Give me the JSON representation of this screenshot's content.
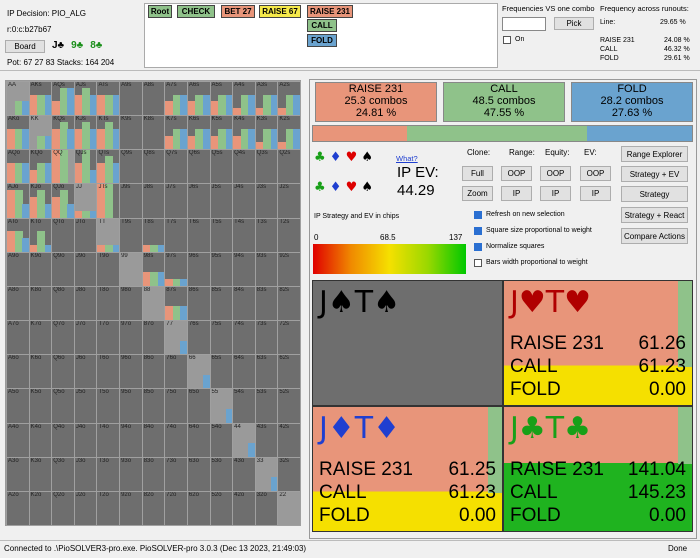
{
  "header": {
    "decision": "IP Decision:  PIO_ALG",
    "board_code": "r:0:c:b27b67",
    "board_button": "Board",
    "board_cards": [
      {
        "r": "J",
        "s": "♣",
        "c": "#000"
      },
      {
        "r": "9",
        "s": "♣",
        "c": "#1a8f1a"
      },
      {
        "r": "8",
        "s": "♣",
        "c": "#1a8f1a"
      }
    ],
    "pot": "Pot: 67 27 83 Stacks: 164 204"
  },
  "tree": {
    "root": "Root",
    "check": "CHECK",
    "bet": "BET 27",
    "raise1": "RAISE 67",
    "raise2": "RAISE 231",
    "call": "CALL",
    "fold": "FOLD"
  },
  "freq_vs_combo": {
    "title": "Frequencies VS one combo",
    "pick": "Pick",
    "on": "On"
  },
  "runouts": {
    "title": "Frequency across runouts:",
    "line_label": "Line:",
    "line_value": "29.65 %",
    "rows": [
      {
        "name": "RAISE 231",
        "pct": "24.08 %"
      },
      {
        "name": "CALL",
        "pct": "46.32 %"
      },
      {
        "name": "FOLD",
        "pct": "29.61 %"
      }
    ]
  },
  "summary": [
    {
      "name": "RAISE 231",
      "combos": "25.3 combos",
      "pct": "24.81 %",
      "color": "#e8957a",
      "frac": 0.2481
    },
    {
      "name": "CALL",
      "combos": "48.5 combos",
      "pct": "47.55 %",
      "color": "#8fc28a",
      "frac": 0.4755
    },
    {
      "name": "FOLD",
      "combos": "28.2 combos",
      "pct": "27.63 %",
      "color": "#6aa3cf",
      "frac": 0.2763
    }
  ],
  "controls": {
    "what": "What?",
    "ip_ev_label": "IP EV:",
    "ip_ev_value": "44.29",
    "clone": "Clone:",
    "range": "Range:",
    "equity": "Equity:",
    "ev": "EV:",
    "full": "Full",
    "zoom": "Zoom",
    "oop1": "OOP",
    "oop2": "OOP",
    "oop3": "OOP",
    "ip1": "IP",
    "ip2": "IP",
    "ip3": "IP",
    "range_explorer": "Range Explorer",
    "strategy_ev": "Strategy + EV",
    "strategy": "Strategy",
    "strategy_react": "Strategy + React",
    "compare": "Compare Actions",
    "grad_title": "IP Strategy and EV in chips",
    "grad_min": "0",
    "grad_mid": "68.5",
    "grad_max": "137",
    "checkboxes": [
      {
        "label": "Refresh on new selection",
        "on": true
      },
      {
        "label": "Square size proportional to weight",
        "on": true
      },
      {
        "label": "Normalize squares",
        "on": true
      },
      {
        "label": "Bars width proportional to weight",
        "on": false
      }
    ]
  },
  "combos": [
    {
      "r1": "J",
      "s1": "♠",
      "r2": "T",
      "s2": "♠",
      "color": "#000",
      "rows": []
    },
    {
      "r1": "J",
      "s1": "♥",
      "r2": "T",
      "s2": "♥",
      "color": "#b00000",
      "rows": [
        {
          "a": "RAISE 231",
          "v": "61.26"
        },
        {
          "a": "CALL",
          "v": "61.23"
        },
        {
          "a": "FOLD",
          "v": "0.00"
        }
      ]
    },
    {
      "r1": "J",
      "s1": "♦",
      "r2": "T",
      "s2": "♦",
      "color": "#1f3fd0",
      "rows": [
        {
          "a": "RAISE 231",
          "v": "61.25"
        },
        {
          "a": "CALL",
          "v": "61.23"
        },
        {
          "a": "FOLD",
          "v": "0.00"
        }
      ]
    },
    {
      "r1": "J",
      "s1": "♣",
      "r2": "T",
      "s2": "♣",
      "color": "#18a018",
      "rows": [
        {
          "a": "RAISE 231",
          "v": "141.04"
        },
        {
          "a": "CALL",
          "v": "145.23"
        },
        {
          "a": "FOLD",
          "v": "0.00"
        }
      ]
    }
  ],
  "ranks": [
    "A",
    "K",
    "Q",
    "J",
    "T",
    "9",
    "8",
    "7",
    "6",
    "5",
    "4",
    "3",
    "2"
  ],
  "status": {
    "left": "Connected to .\\PioSOLVER3-pro.exe. PioSOLVER-pro 3.0.3 (Dec 13 2023, 21:49:03)",
    "right": "Done"
  }
}
